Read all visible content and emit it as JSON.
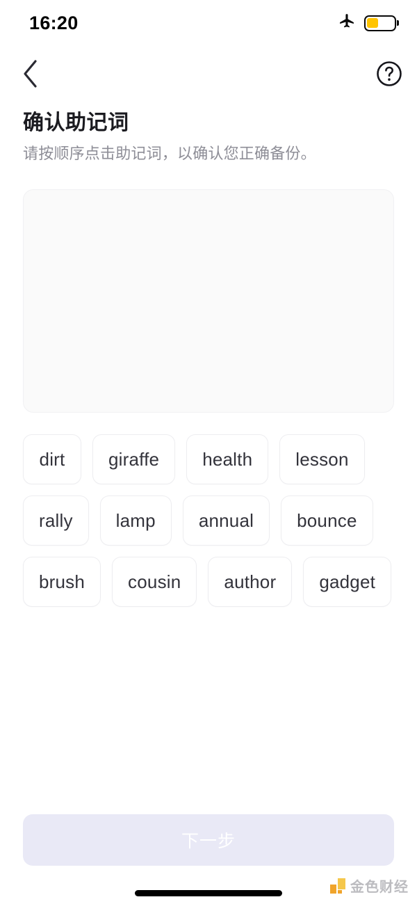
{
  "status_bar": {
    "time": "16:20",
    "airplane_icon": "airplane-mode-icon",
    "battery_icon": "battery-icon",
    "battery_level_percent": 42,
    "battery_color": "#FFC400"
  },
  "nav_bar": {
    "back_icon": "chevron-left-icon",
    "help_icon": "help-circle-icon"
  },
  "header": {
    "title": "确认助记词",
    "subtitle": "请按顺序点击助记词，以确认您正确备份。"
  },
  "selection_panel": {
    "selected_words": [],
    "background_color": "#fafafa",
    "border_color": "#f1f1f3"
  },
  "word_bank": {
    "words": [
      "dirt",
      "giraffe",
      "health",
      "lesson",
      "rally",
      "lamp",
      "annual",
      "bounce",
      "brush",
      "cousin",
      "author",
      "gadget"
    ]
  },
  "footer": {
    "next_label": "下一步",
    "next_enabled": false,
    "next_background_color": "#e9e9f6",
    "next_text_color": "#ffffff"
  },
  "watermark": {
    "text": "金色财经",
    "accent_color": "#F5C542"
  }
}
